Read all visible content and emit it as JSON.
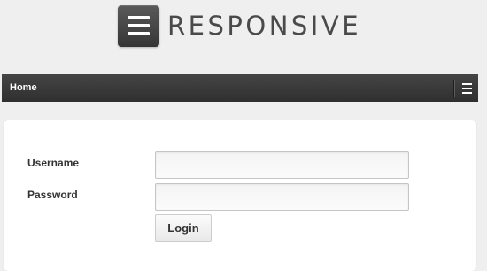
{
  "header": {
    "logo_text": "RESPONSIVE",
    "logo_icon": "menu-lines-icon"
  },
  "nav": {
    "home_label": "Home",
    "toggle_icon": "hamburger-icon"
  },
  "form": {
    "username_label": "Username",
    "username_value": "",
    "password_label": "Password",
    "password_value": "",
    "login_label": "Login"
  },
  "colors": {
    "page_background": "#efefef",
    "nav_background": "#3a3a3a",
    "panel_background": "#ffffff",
    "text": "#333333"
  }
}
